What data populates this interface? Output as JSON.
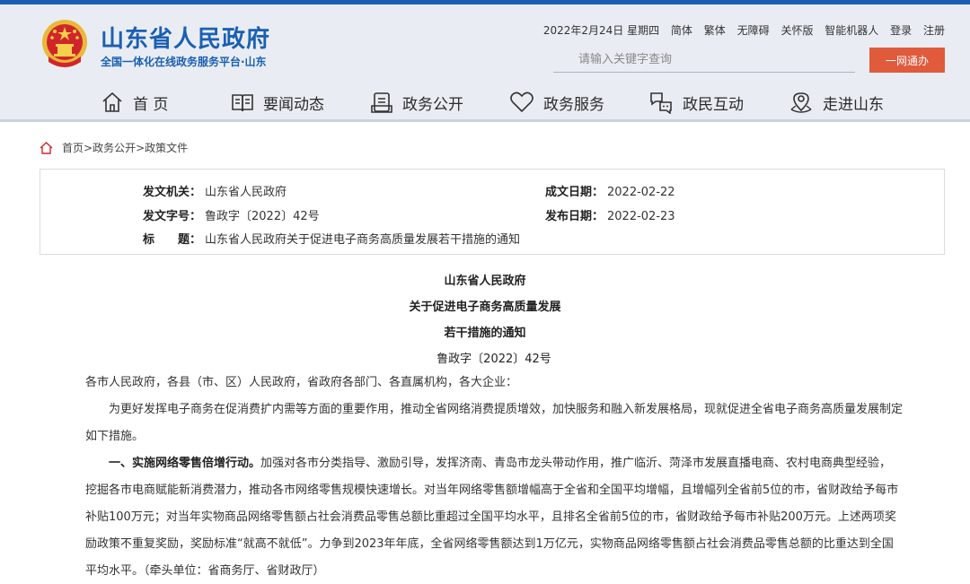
{
  "header": {
    "title": "山东省人民政府",
    "subtitle": "全国一体化在线政务服务平台·山东",
    "date": "2022年2月24日 星期四",
    "links": [
      "简体",
      "繁体",
      "无障碍",
      "关怀版",
      "智能机器人",
      "登录",
      "注册"
    ],
    "search_placeholder": "请输入关键字查询",
    "login_button": "一网通办"
  },
  "nav": {
    "items": [
      {
        "label": "首 页",
        "icon": "home-icon"
      },
      {
        "label": "要闻动态",
        "icon": "book-icon"
      },
      {
        "label": "政务公开",
        "icon": "document-icon"
      },
      {
        "label": "政务服务",
        "icon": "heart-icon"
      },
      {
        "label": "政民互动",
        "icon": "chat-icon"
      },
      {
        "label": "走进山东",
        "icon": "location-icon"
      }
    ]
  },
  "breadcrumb": {
    "home": "首页",
    "sep": ">",
    "level1": "政务公开",
    "level2": "政策文件"
  },
  "meta": {
    "issuer_label": "发文机关：",
    "issuer": "山东省人民政府",
    "doc_no_label": "发文字号：",
    "doc_no": "鲁政字〔2022〕42号",
    "title_label": "标　　题：",
    "title": "山东省人民政府关于促进电子商务高质量发展若干措施的通知",
    "created_label": "成文日期：",
    "created": "2022-02-22",
    "published_label": "发布日期：",
    "published": "2022-02-23"
  },
  "document": {
    "heading_1": "山东省人民政府",
    "heading_2": "关于促进电子商务高质量发展",
    "heading_3": "若干措施的通知",
    "doc_no": "鲁政字〔2022〕42号",
    "addressee": "各市人民政府，各县（市、区）人民政府，省政府各部门、各直属机构，各大企业：",
    "intro": "为更好发挥电子商务在促消费扩内需等方面的重要作用，推动全省网络消费提质增效，加快服务和融入新发展格局，现就促进全省电子商务高质量发展制定如下措施。",
    "section1_title": "一、实施网络零售倍增行动。",
    "section1_body": "加强对各市分类指导、激励引导，发挥济南、青岛市龙头带动作用，推广临沂、菏泽市发展直播电商、农村电商典型经验，挖掘各市电商赋能新消费潜力，推动各市网络零售规模快速增长。对当年网络零售额增幅高于全省和全国平均增幅，且增幅列全省前5位的市，省财政给予每市补贴100万元；对当年实物商品网络零售额占社会消费品零售总额比重超过全国平均水平，且排名全省前5位的市，省财政给予每市补贴200万元。上述两项奖励政策不重复奖励，奖励标准“就高不就低”。力争到2023年年底，全省网络零售额达到1万亿元，实物商品网络零售额占社会消费品零售总额的比重达到全国平均水平。（牵头单位：省商务厅、省财政厅）"
  },
  "colors": {
    "brand_blue": "#1b5fb3",
    "header_bg": "#e9edf3",
    "button_red": "#e05a3c"
  }
}
